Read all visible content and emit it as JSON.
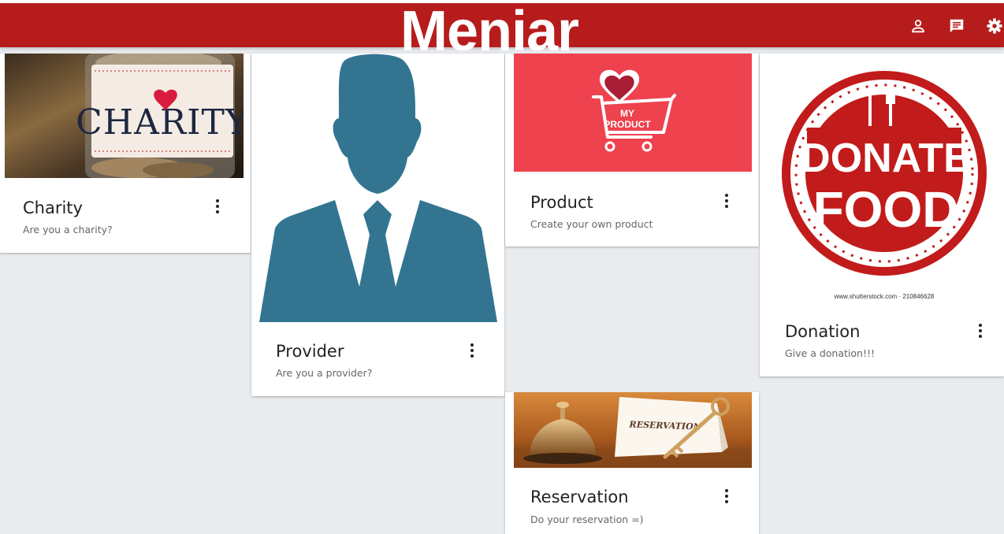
{
  "app": {
    "brand": "Meniar",
    "icons": [
      "account-icon",
      "chat-icon",
      "settings-icon"
    ]
  },
  "colors": {
    "appbar": "#b71c1c",
    "background": "#e9ecef",
    "provider_silhouette": "#337591",
    "product_bg": "#ef424f",
    "donate_red": "#c21b1b"
  },
  "cards": {
    "charity": {
      "title": "Charity",
      "subtitle": "Are you a charity?",
      "image_text": "CHARITY"
    },
    "provider": {
      "title": "Provider",
      "subtitle": "Are you a provider?"
    },
    "product": {
      "title": "Product",
      "subtitle": "Create your own product",
      "image_text_1": "MY",
      "image_text_2": "PRODUCT"
    },
    "donation": {
      "title": "Donation",
      "subtitle": "Give a donation!!!",
      "image_text_1": "DONATE",
      "image_text_2": "FOOD",
      "image_caption": "www.shutterstock.com · 210846628"
    },
    "reservation": {
      "title": "Reservation",
      "subtitle": "Do your reservation =)",
      "image_text": "RESERVATION"
    }
  }
}
